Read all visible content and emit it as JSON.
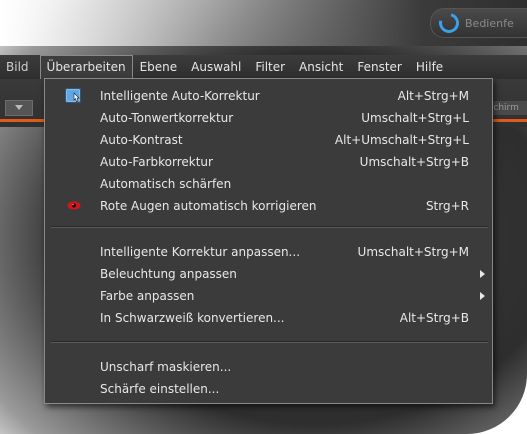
{
  "window": {
    "help_search_label": "Bedienfe",
    "toolbar_right_label": "dschirm"
  },
  "menubar": {
    "items": [
      {
        "label": "Bild"
      },
      {
        "label": "Überarbeiten"
      },
      {
        "label": "Ebene"
      },
      {
        "label": "Auswahl"
      },
      {
        "label": "Filter"
      },
      {
        "label": "Ansicht"
      },
      {
        "label": "Fenster"
      },
      {
        "label": "Hilfe"
      }
    ],
    "active_index": 1
  },
  "menu": {
    "items": [
      {
        "label": "Intelligente Auto-Korrektur",
        "shortcut": "Alt+Strg+M",
        "icon": "smart-fix-icon"
      },
      {
        "label": "Auto-Tonwertkorrektur",
        "shortcut": "Umschalt+Strg+L"
      },
      {
        "label": "Auto-Kontrast",
        "shortcut": "Alt+Umschalt+Strg+L"
      },
      {
        "label": "Auto-Farbkorrektur",
        "shortcut": "Umschalt+Strg+B"
      },
      {
        "label": "Automatisch schärfen",
        "shortcut": ""
      },
      {
        "label": "Rote Augen automatisch korrigieren",
        "shortcut": "Strg+R",
        "icon": "red-eye-icon"
      },
      {
        "label": "Intelligente Korrektur anpassen...",
        "shortcut": "Umschalt+Strg+M"
      },
      {
        "label": "Beleuchtung anpassen",
        "shortcut": "",
        "submenu": true
      },
      {
        "label": "Farbe anpassen",
        "shortcut": "",
        "submenu": true
      },
      {
        "label": "In Schwarzweiß konvertieren...",
        "shortcut": "Alt+Strg+B"
      },
      {
        "label": "Unscharf maskieren...",
        "shortcut": ""
      },
      {
        "label": "Schärfe einstellen...",
        "shortcut": ""
      }
    ]
  },
  "colors": {
    "accent_orange": "#e05a1a",
    "menu_bg": "#3b3b3b",
    "red_eye": "#d01818",
    "help_icon_blue": "#3aa0e8"
  }
}
